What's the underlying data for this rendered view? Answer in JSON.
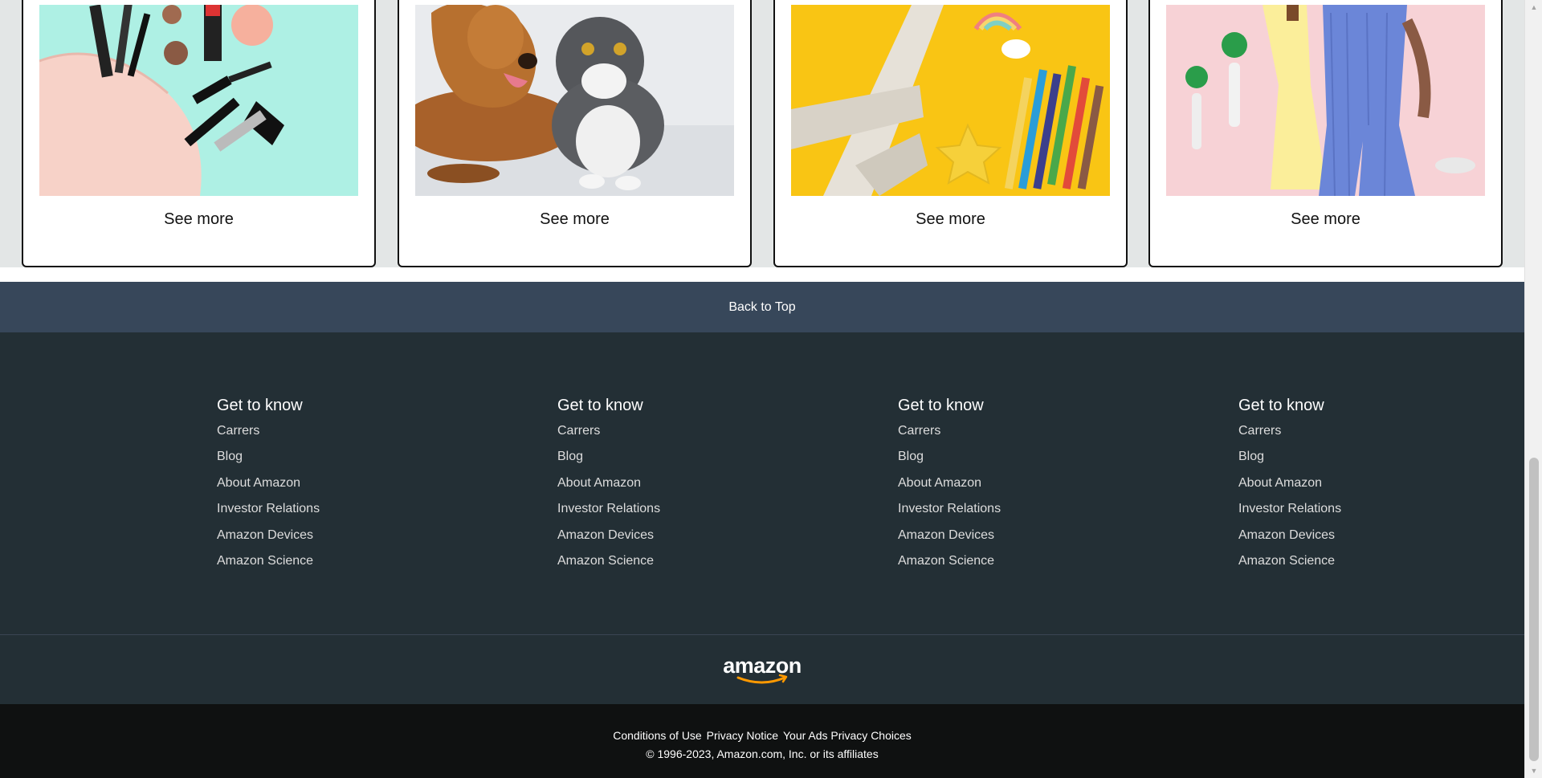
{
  "cards": [
    {
      "id": "beauty",
      "image_name": "beauty-products-image",
      "see_more_label": "See more"
    },
    {
      "id": "pets",
      "image_name": "pets-image",
      "see_more_label": "See more"
    },
    {
      "id": "toys",
      "image_name": "toys-crafts-image",
      "see_more_label": "See more"
    },
    {
      "id": "fashion",
      "image_name": "fashion-image",
      "see_more_label": "See more"
    }
  ],
  "back_to_top": {
    "label": "Back to Top"
  },
  "footer": {
    "columns": [
      {
        "heading": "Get to know",
        "links": [
          "Carrers",
          "Blog",
          "About Amazon",
          "Investor Relations",
          "Amazon Devices",
          "Amazon Science"
        ]
      },
      {
        "heading": "Get to know",
        "links": [
          "Carrers",
          "Blog",
          "About Amazon",
          "Investor Relations",
          "Amazon Devices",
          "Amazon Science"
        ]
      },
      {
        "heading": "Get to know",
        "links": [
          "Carrers",
          "Blog",
          "About Amazon",
          "Investor Relations",
          "Amazon Devices",
          "Amazon Science"
        ]
      },
      {
        "heading": "Get to know",
        "links": [
          "Carrers",
          "Blog",
          "About Amazon",
          "Investor Relations",
          "Amazon Devices",
          "Amazon Science"
        ]
      }
    ],
    "logo_text": "amazon",
    "bottom_links": [
      "Conditions of Use",
      "Privacy Notice",
      "Your Ads Privacy Choices"
    ],
    "copyright": "© 1996-2023, Amazon.com, Inc. or its affiliates"
  },
  "colors": {
    "page_bg": "#e3e6e6",
    "back_to_top_bg": "#37475a",
    "footer_bg": "#232f35",
    "footer_bottom_bg": "#0f1111",
    "logo_smile": "#ff9900"
  }
}
